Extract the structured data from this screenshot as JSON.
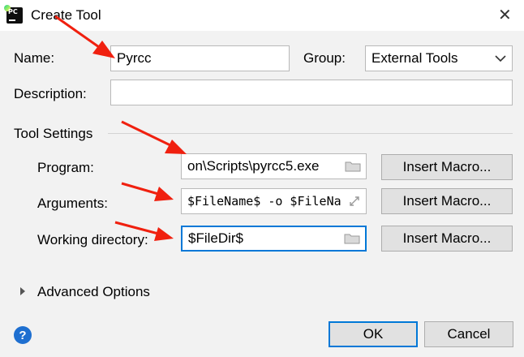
{
  "window": {
    "title": "Create Tool",
    "close_glyph": "✕"
  },
  "form": {
    "name_label": "Name:",
    "name_value": "Pyrcc",
    "group_label": "Group:",
    "group_value": "External Tools",
    "description_label": "Description:",
    "description_value": ""
  },
  "tool_settings": {
    "section_label": "Tool Settings",
    "program_label": "Program:",
    "program_value": "on\\Scripts\\pyrcc5.exe",
    "arguments_label": "Arguments:",
    "arguments_value": "$FileName$ -o $FileNa",
    "working_dir_label": "Working directory:",
    "working_dir_value": "$FileDir$",
    "insert_macro_label": "Insert Macro..."
  },
  "advanced": {
    "label": "Advanced Options"
  },
  "footer": {
    "help_glyph": "?",
    "ok_label": "OK",
    "cancel_label": "Cancel"
  },
  "colors": {
    "accent": "#0078d7",
    "arrow": "#f0200f",
    "help": "#1e6fd0"
  }
}
